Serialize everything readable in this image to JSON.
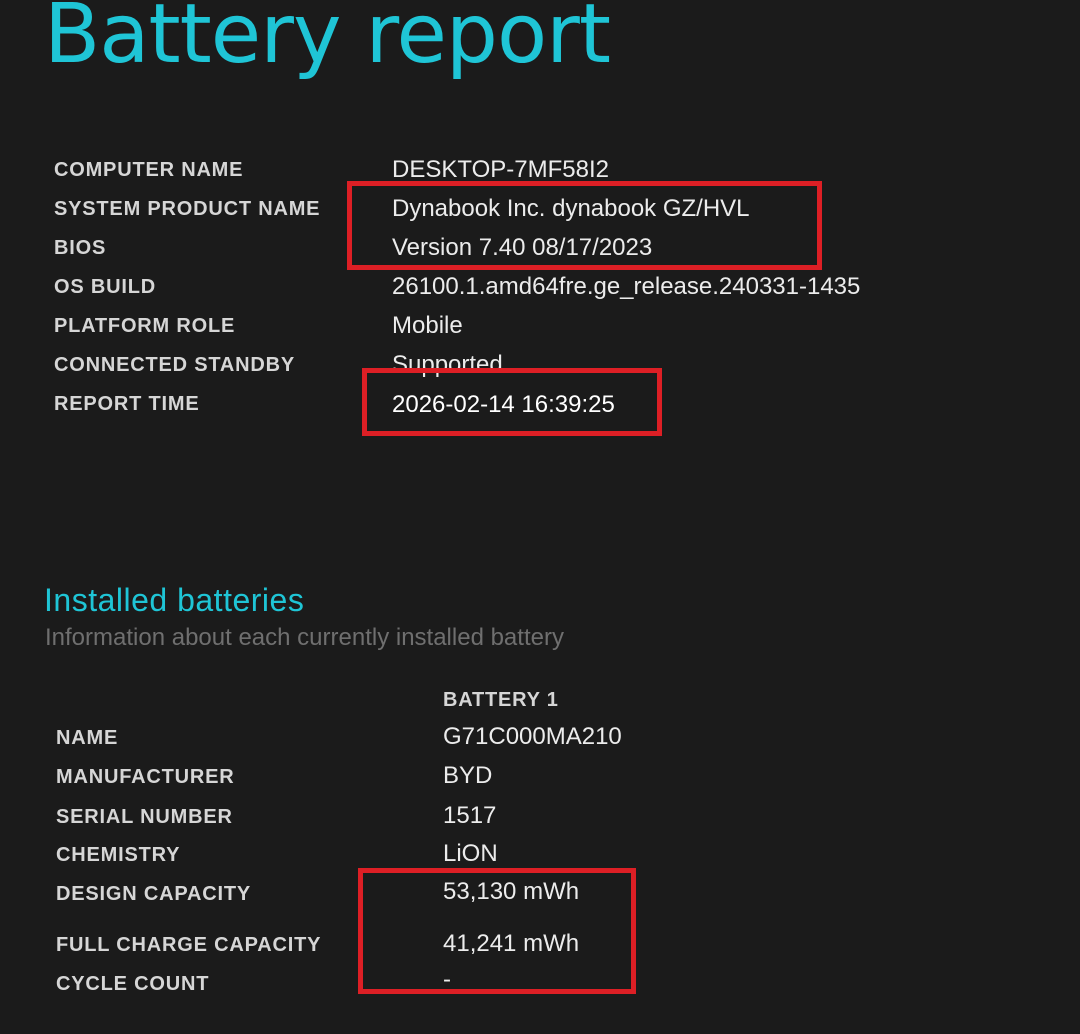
{
  "report": {
    "title": "Battery report"
  },
  "system_info": {
    "rows": [
      {
        "label": "COMPUTER NAME",
        "value": "DESKTOP-7MF58I2"
      },
      {
        "label": "SYSTEM PRODUCT NAME",
        "value": "Dynabook Inc. dynabook GZ/HVL"
      },
      {
        "label": "BIOS",
        "value": "Version 7.40 08/17/2023"
      },
      {
        "label": "OS BUILD",
        "value": "26100.1.amd64fre.ge_release.240331-1435"
      },
      {
        "label": "PLATFORM ROLE",
        "value": "Mobile"
      },
      {
        "label": "CONNECTED STANDBY",
        "value": "Supported"
      },
      {
        "label": "REPORT TIME",
        "value": "2026-02-14  16:39:25"
      }
    ]
  },
  "installed_batteries": {
    "title": "Installed batteries",
    "subtitle": "Information about each currently installed battery",
    "column_header": "BATTERY 1",
    "rows": [
      {
        "label": "NAME",
        "value": "G71C000MA210"
      },
      {
        "label": "MANUFACTURER",
        "value": "BYD"
      },
      {
        "label": "SERIAL NUMBER",
        "value": "1517"
      },
      {
        "label": "CHEMISTRY",
        "value": "LiON"
      },
      {
        "label": "DESIGN CAPACITY",
        "value": "53,130 mWh"
      },
      {
        "label": "FULL CHARGE CAPACITY",
        "value": "41,241 mWh"
      },
      {
        "label": "CYCLE COUNT",
        "value": "-"
      }
    ]
  },
  "annotations": {
    "highlight_color": "#dd1f25",
    "accent_color": "#1fc5d6"
  }
}
